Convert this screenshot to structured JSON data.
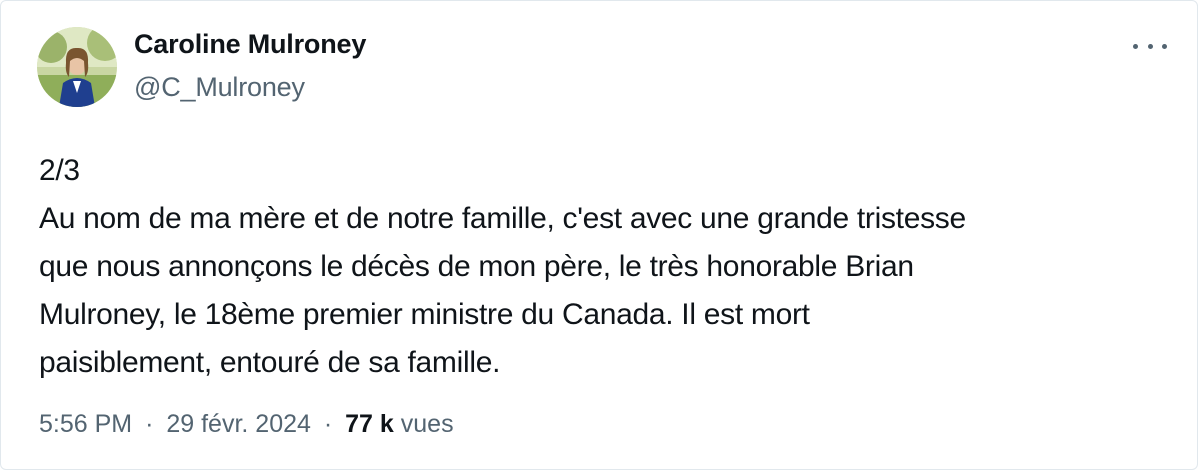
{
  "author": {
    "display_name": "Caroline Mulroney",
    "handle": "@C_Mulroney",
    "avatar": "profile-photo"
  },
  "menu_icon": "more-horizontal-icon",
  "tweet": {
    "lines": [
      "2/3",
      "Au nom de ma mère et de notre famille, c'est avec une grande tristesse",
      "que nous annonçons le décès de mon père, le très honorable Brian",
      "Mulroney, le 18ème premier ministre du Canada. Il est mort",
      "paisiblement, entouré de sa famille."
    ]
  },
  "meta": {
    "time": "5:56 PM",
    "separator": "·",
    "date": "29 févr. 2024",
    "views_count": "77 k",
    "views_label": "vues"
  },
  "colors": {
    "text": "#0f1419",
    "secondary": "#536471",
    "border": "#e1e8ed"
  }
}
